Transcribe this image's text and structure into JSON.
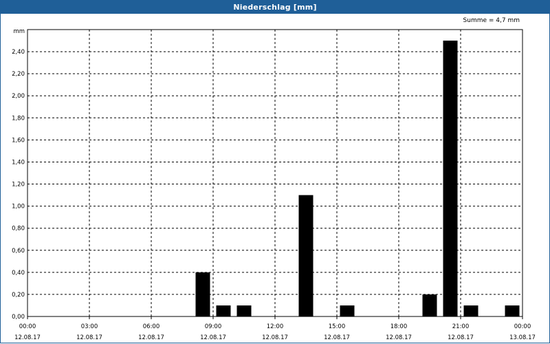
{
  "title": "Niederschlag [mm]",
  "sum_label": "Summe = 4,7 mm",
  "chart_data": {
    "type": "bar",
    "title": "Niederschlag [mm]",
    "ylabel": "mm",
    "ylim": [
      0,
      2.6
    ],
    "yticks": [
      0,
      0.2,
      0.4,
      0.6,
      0.8,
      1.0,
      1.2,
      1.4,
      1.6,
      1.8,
      2.0,
      2.2,
      2.4
    ],
    "ytick_labels": [
      "0,00",
      "0,20",
      "0,40",
      "0,60",
      "0,80",
      "1,00",
      "1,20",
      "1,40",
      "1,60",
      "1,80",
      "2,00",
      "2,20",
      "2,40"
    ],
    "xlim_hours": [
      0,
      24
    ],
    "xticks": [
      {
        "time": "00:00",
        "date": "12.08.17",
        "hour": 0
      },
      {
        "time": "03:00",
        "date": "12.08.17",
        "hour": 3
      },
      {
        "time": "06:00",
        "date": "12.08.17",
        "hour": 6
      },
      {
        "time": "09:00",
        "date": "12.08.17",
        "hour": 9
      },
      {
        "time": "12:00",
        "date": "12.08.17",
        "hour": 12
      },
      {
        "time": "15:00",
        "date": "12.08.17",
        "hour": 15
      },
      {
        "time": "18:00",
        "date": "12.08.17",
        "hour": 18
      },
      {
        "time": "21:00",
        "date": "12.08.17",
        "hour": 21
      },
      {
        "time": "00:00",
        "date": "13.08.17",
        "hour": 24
      }
    ],
    "bars": [
      {
        "time": "08:30",
        "hour": 8.5,
        "value": 0.4
      },
      {
        "time": "09:30",
        "hour": 9.5,
        "value": 0.1
      },
      {
        "time": "10:30",
        "hour": 10.5,
        "value": 0.1
      },
      {
        "time": "13:30",
        "hour": 13.5,
        "value": 1.1
      },
      {
        "time": "15:30",
        "hour": 15.5,
        "value": 0.1
      },
      {
        "time": "19:30",
        "hour": 19.5,
        "value": 0.2
      },
      {
        "time": "20:30",
        "hour": 20.5,
        "value": 2.5
      },
      {
        "time": "21:30",
        "hour": 21.5,
        "value": 0.1
      },
      {
        "time": "23:30",
        "hour": 23.5,
        "value": 0.1
      }
    ],
    "bar_color": "#000000",
    "grid": true,
    "grid_style": "dashed"
  }
}
